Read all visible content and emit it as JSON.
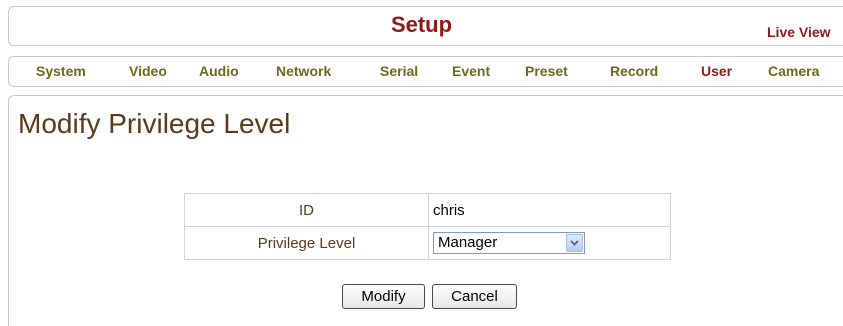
{
  "header": {
    "title": "Setup",
    "live_view_link": "Live View"
  },
  "nav": {
    "items": [
      {
        "label": "System"
      },
      {
        "label": "Video"
      },
      {
        "label": "Audio"
      },
      {
        "label": "Network"
      },
      {
        "label": "Serial"
      },
      {
        "label": "Event"
      },
      {
        "label": "Preset"
      },
      {
        "label": "Record"
      },
      {
        "label": "User"
      },
      {
        "label": "Camera"
      }
    ],
    "active": "User"
  },
  "page": {
    "heading": "Modify Privilege Level"
  },
  "form": {
    "id_label": "ID",
    "id_value": "chris",
    "privilege_label": "Privilege Level",
    "privilege_value": "Manager"
  },
  "buttons": {
    "modify_label": "Modify",
    "cancel_label": "Cancel"
  },
  "colors": {
    "title": "#8b1a1a",
    "nav_text": "#6b6b1a",
    "nav_active": "#8b1a1a",
    "heading": "#5a3a1a"
  }
}
